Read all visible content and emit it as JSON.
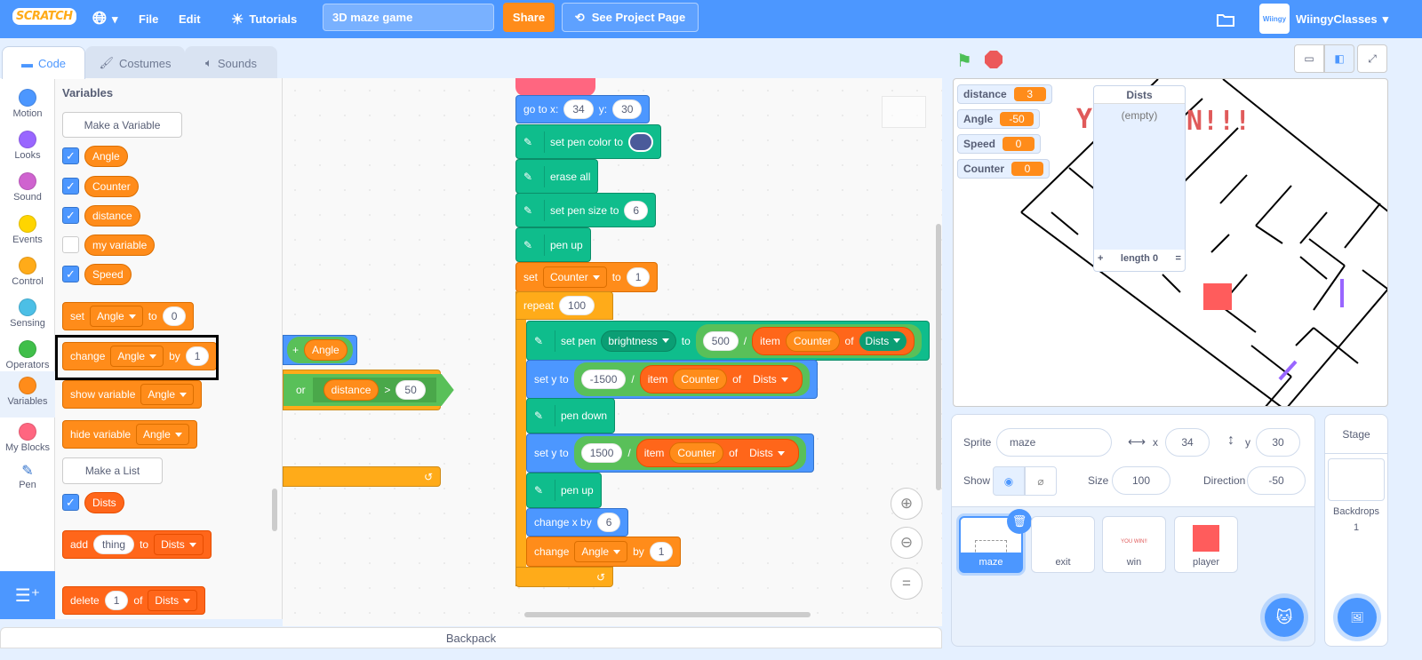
{
  "menubar": {
    "logo": "SCRATCH",
    "file": "File",
    "edit": "Edit",
    "tutorials": "Tutorials",
    "project_title": "3D maze game",
    "share": "Share",
    "see_project_page": "See Project Page",
    "username": "WiingyClasses",
    "avatar_text": "Wiingy",
    "color": "#4c97ff"
  },
  "tabs": [
    {
      "label": "Code"
    },
    {
      "label": "Costumes"
    },
    {
      "label": "Sounds"
    }
  ],
  "categories": [
    {
      "label": "Motion",
      "color": "#4c97ff"
    },
    {
      "label": "Looks",
      "color": "#9966ff"
    },
    {
      "label": "Sound",
      "color": "#cf63cf"
    },
    {
      "label": "Events",
      "color": "#ffd500"
    },
    {
      "label": "Control",
      "color": "#ffab19"
    },
    {
      "label": "Sensing",
      "color": "#4cbfe6"
    },
    {
      "label": "Operators",
      "color": "#40bf4a"
    },
    {
      "label": "Variables",
      "color": "#ff8c1a"
    },
    {
      "label": "My Blocks",
      "color": "#ff6680"
    },
    {
      "label": "Pen",
      "color": ""
    }
  ],
  "palette": {
    "title": "Variables",
    "make_variable": "Make a Variable",
    "variables": [
      {
        "name": "Angle",
        "checked": true
      },
      {
        "name": "Counter",
        "checked": true
      },
      {
        "name": "distance",
        "checked": true
      },
      {
        "name": "my variable",
        "checked": false
      },
      {
        "name": "Speed",
        "checked": true
      }
    ],
    "set_block": {
      "op": "set",
      "var": "Angle",
      "to": "to",
      "value": "0"
    },
    "change_block": {
      "op": "change",
      "var": "Angle",
      "by": "by",
      "value": "1"
    },
    "show_block": {
      "op": "show variable",
      "var": "Angle"
    },
    "hide_block": {
      "op": "hide variable",
      "var": "Angle"
    },
    "make_list": "Make a List",
    "list": {
      "name": "Dists",
      "checked": true
    },
    "add_block": {
      "op": "add",
      "value": "thing",
      "to": "to",
      "list": "Dists"
    },
    "delete_block": {
      "op": "delete",
      "value": "1",
      "of": "of",
      "list": "Dists"
    }
  },
  "overflow_blocks": {
    "plus": "+",
    "angle": "Angle",
    "or": "or",
    "distance": "distance",
    "gt": ">",
    "value": "50"
  },
  "script": {
    "goto": {
      "label": "go to x:",
      "x": "34",
      "ylabel": "y:",
      "y": "30"
    },
    "set_pen_color": {
      "label": "set pen color to",
      "color": "#4a5a9a"
    },
    "erase_all": "erase all",
    "set_pen_size": {
      "label": "set pen size to",
      "value": "6"
    },
    "pen_up": "pen up",
    "set_counter": {
      "op": "set",
      "var": "Counter",
      "to": "to",
      "value": "1"
    },
    "repeat": {
      "label": "repeat",
      "value": "100"
    },
    "set_pen_brightness": {
      "label": "set pen",
      "param": "brightness",
      "to": "to",
      "num": "500",
      "div": "/",
      "item": "item",
      "index": "Counter",
      "of": "of",
      "list": "Dists"
    },
    "set_y_1": {
      "label": "set y to",
      "num": "-1500",
      "div": "/",
      "item": "item",
      "index": "Counter",
      "of": "of",
      "list": "Dists"
    },
    "pen_down": "pen down",
    "set_y_2": {
      "label": "set y to",
      "num": "1500",
      "div": "/",
      "item": "item",
      "index": "Counter",
      "of": "of",
      "list": "Dists"
    },
    "pen_up_2": "pen up",
    "change_x": {
      "label": "change x by",
      "value": "6"
    },
    "change_angle": {
      "op": "change",
      "var": "Angle",
      "by": "by",
      "value": "1"
    }
  },
  "backpack": "Backpack",
  "stage": {
    "monitors": [
      {
        "name": "distance",
        "value": "3"
      },
      {
        "name": "Angle",
        "value": "-50"
      },
      {
        "name": "Speed",
        "value": "0"
      },
      {
        "name": "Counter",
        "value": "0"
      }
    ],
    "list_monitor": {
      "title": "Dists",
      "empty": "(empty)",
      "add": "+",
      "length": "length 0",
      "resize": "="
    },
    "win_text_left": "Y",
    "win_text_right": "N!!!"
  },
  "sprite_info": {
    "sprite_label": "Sprite",
    "sprite_name": "maze",
    "x_label": "x",
    "x": "34",
    "y_label": "y",
    "y": "30",
    "show_label": "Show",
    "size_label": "Size",
    "size": "100",
    "direction_label": "Direction",
    "direction": "-50"
  },
  "sprites": [
    {
      "name": "maze",
      "selected": true
    },
    {
      "name": "exit",
      "selected": false
    },
    {
      "name": "win",
      "selected": false,
      "thumb_text": "YOU WIN!!"
    },
    {
      "name": "player",
      "selected": false
    }
  ],
  "stage_pane": {
    "title": "Stage",
    "backdrops_label": "Backdrops",
    "backdrops_count": "1"
  }
}
